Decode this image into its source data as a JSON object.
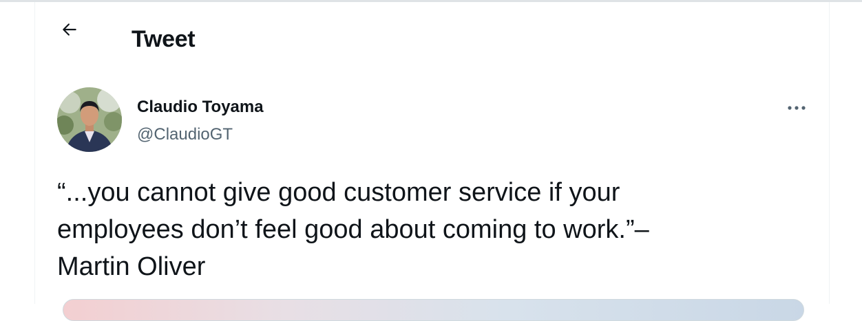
{
  "header": {
    "title": "Tweet",
    "back_icon": "arrow-left-icon"
  },
  "tweet": {
    "author": {
      "display_name": "Claudio Toyama",
      "handle": "@ClaudioGT",
      "avatar_icon": "profile-photo"
    },
    "more_icon": "more-dots-icon",
    "text": "“...you cannot give good customer service if your\nemployees don’t feel good about coming to work.”–\nMartin Oliver"
  },
  "colors": {
    "text_primary": "#0f1419",
    "text_secondary": "#536471",
    "divider": "#eff3f4"
  }
}
